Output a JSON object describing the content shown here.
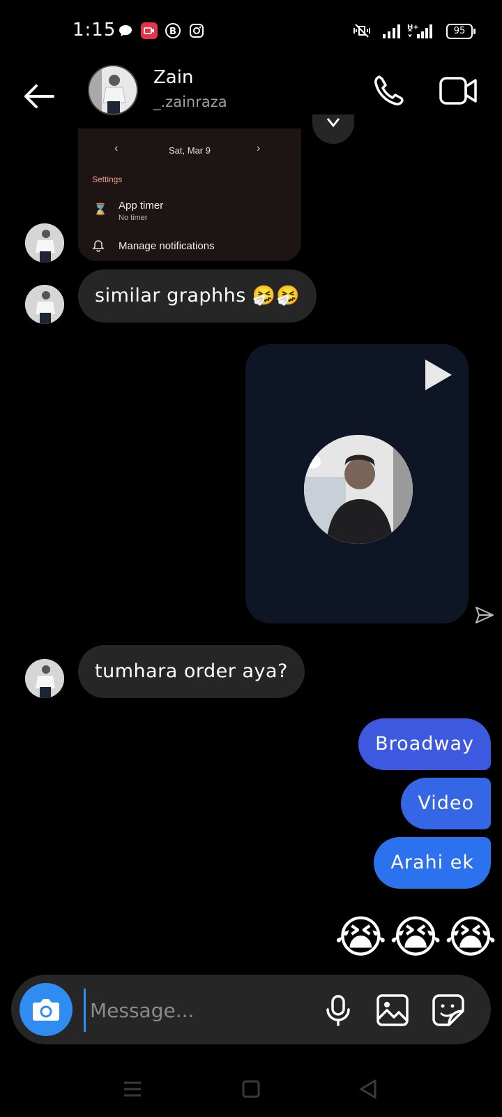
{
  "status_bar": {
    "time": "1:15",
    "battery": "95"
  },
  "header": {
    "name": "Zain",
    "username": "_.zainraza"
  },
  "shared_screenshot": {
    "date": "Sat, Mar 9",
    "prev_arrow": "‹",
    "next_arrow": "›",
    "section": "Settings",
    "rows": [
      {
        "title": "App timer",
        "subtitle": "No timer"
      },
      {
        "title": "Manage notifications"
      }
    ]
  },
  "messages": {
    "incoming_1": "similar graphhs 🤧🤧",
    "incoming_2": "tumhara order aya?",
    "outgoing_1": "Broadway",
    "outgoing_2": "Video",
    "outgoing_3": "Arahi ek",
    "emoji_reaction": "😭😭😭"
  },
  "composer": {
    "placeholder": "Message..."
  },
  "colors": {
    "bubble_incoming": "#262626",
    "bubble_outgoing_1": "#3c59e0",
    "bubble_outgoing_2": "#3466e6",
    "bubble_outgoing_3": "#2c72ee",
    "camera_button": "#2f8cf0",
    "background": "#000000"
  }
}
